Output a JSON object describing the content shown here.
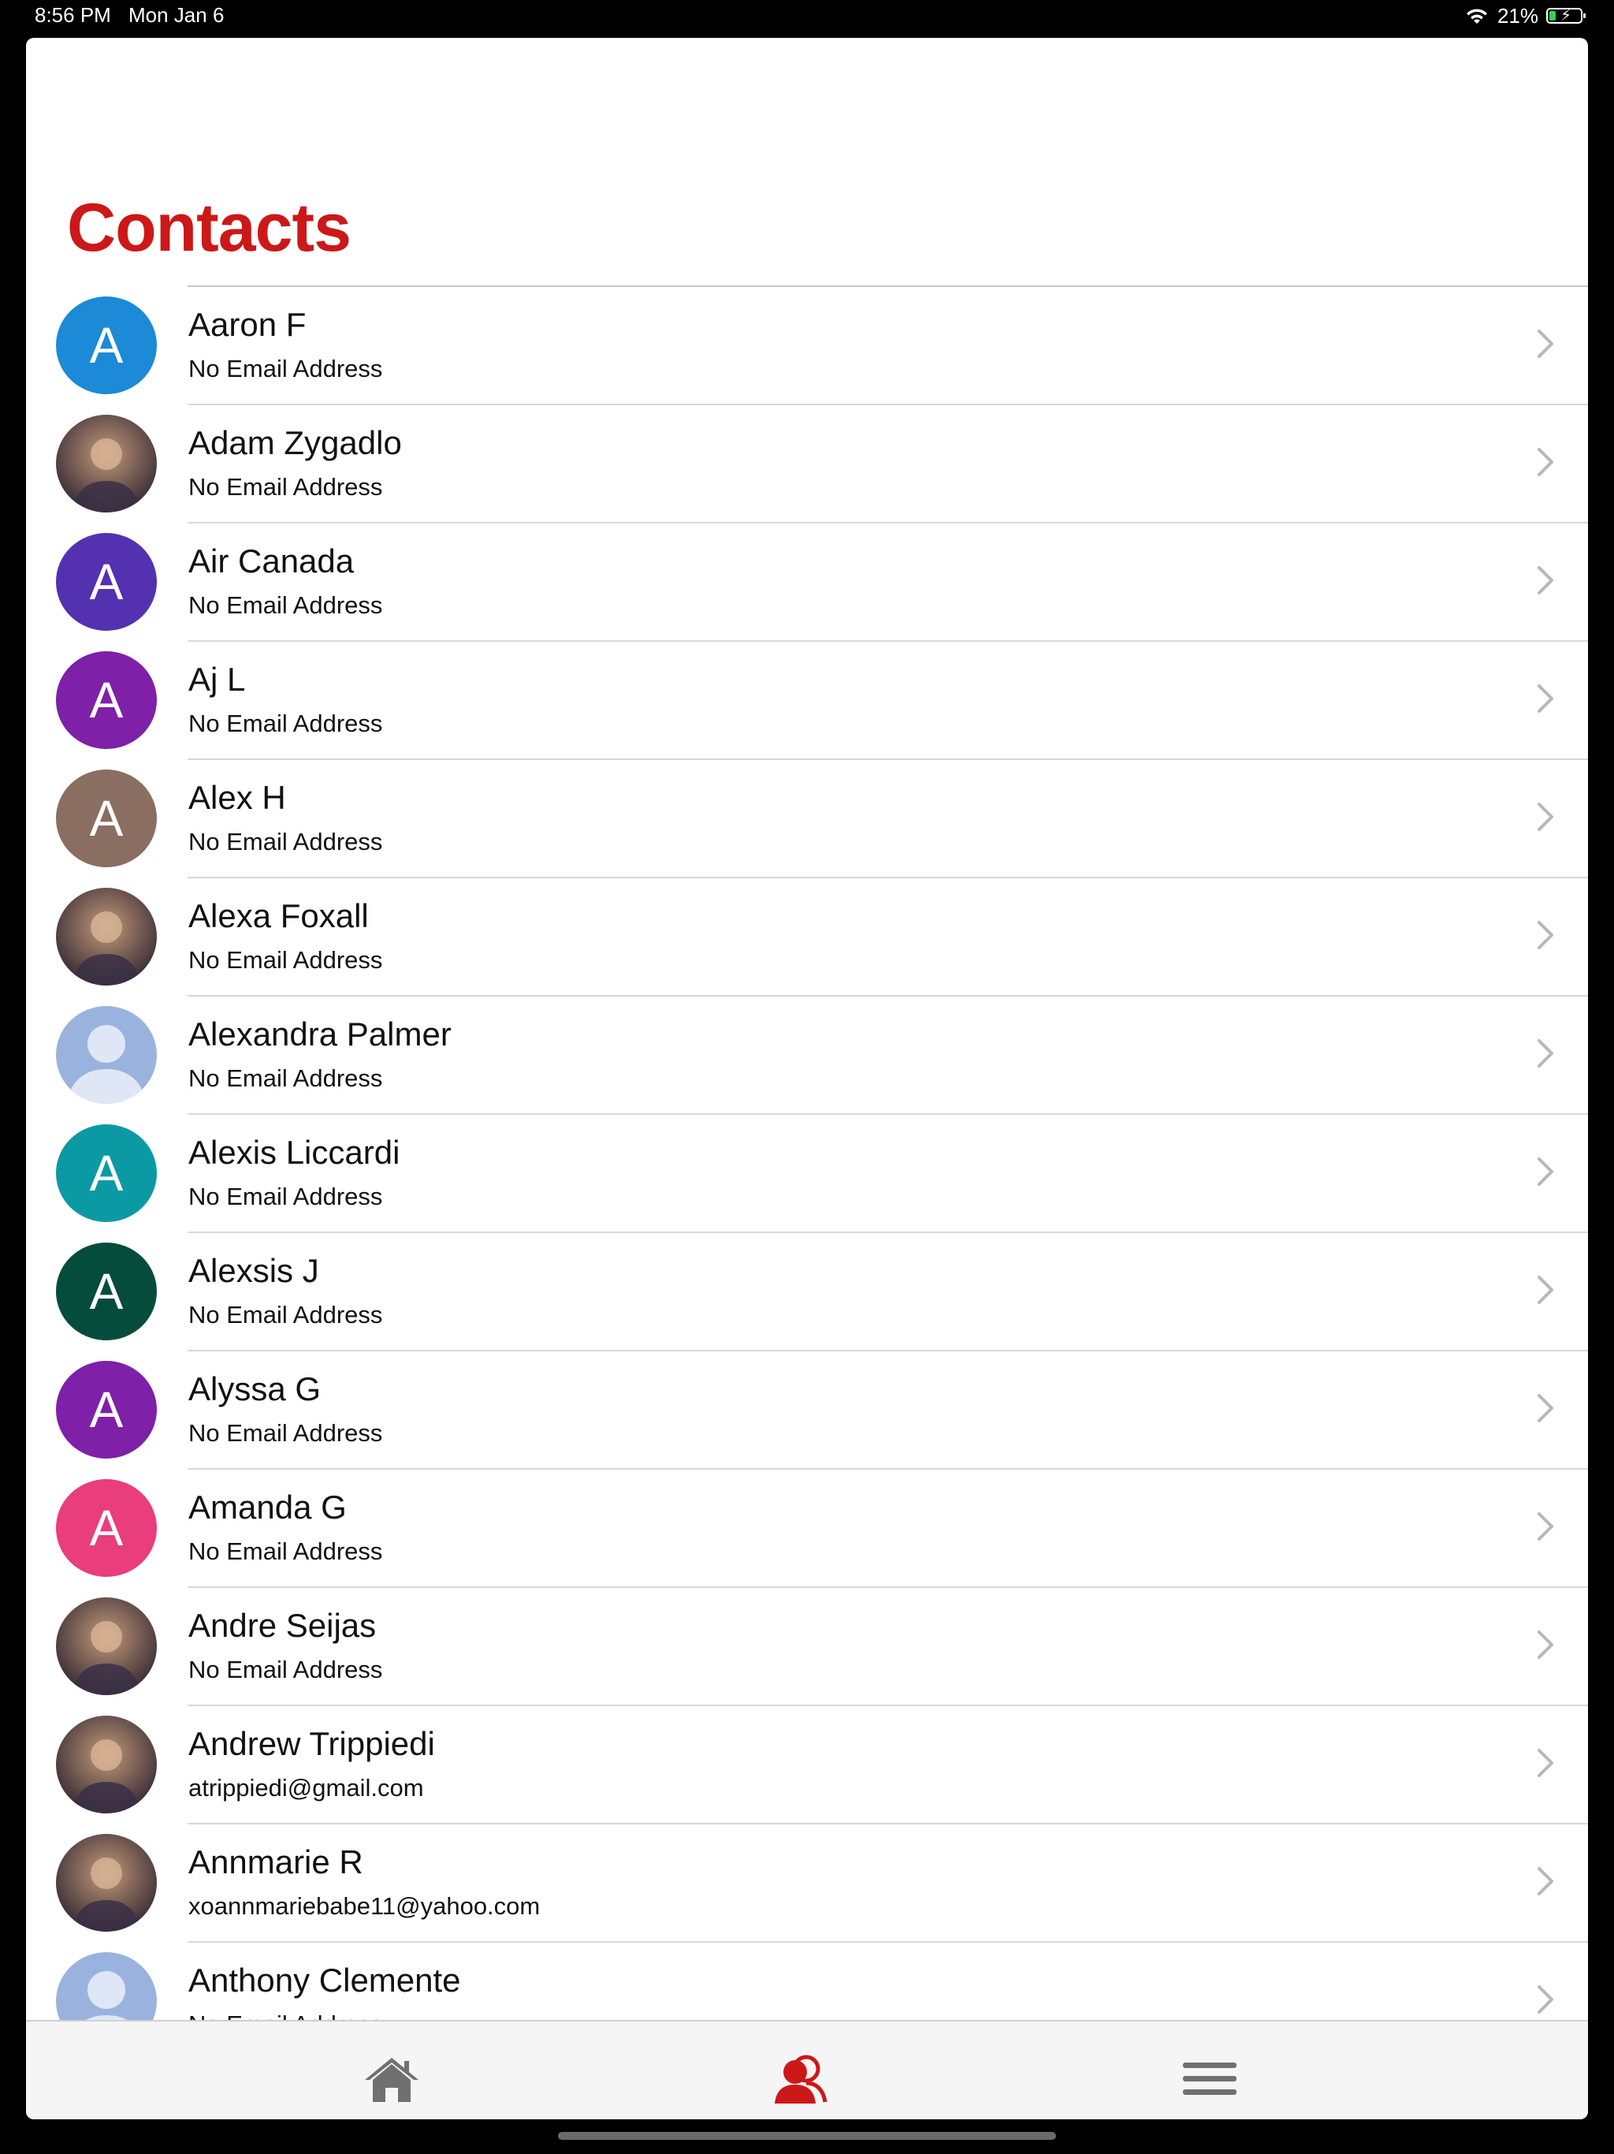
{
  "status": {
    "time": "8:56 PM",
    "date": "Mon Jan 6",
    "battery_percent": "21%",
    "battery_level": 0.21
  },
  "page": {
    "title": "Contacts"
  },
  "colors": {
    "accent": "#cc1818",
    "tab_inactive": "#707070"
  },
  "contacts": [
    {
      "name": "Aaron F",
      "email": "No Email Address",
      "avatar": {
        "type": "initial",
        "letter": "A",
        "color": "#1c8ad6"
      }
    },
    {
      "name": "Adam Zygadlo",
      "email": "No Email Address",
      "avatar": {
        "type": "photo",
        "icon": "photo-avatar-icon"
      }
    },
    {
      "name": "Air Canada",
      "email": "No Email Address",
      "avatar": {
        "type": "initial",
        "letter": "A",
        "color": "#5431b0"
      }
    },
    {
      "name": "Aj L",
      "email": "No Email Address",
      "avatar": {
        "type": "initial",
        "letter": "A",
        "color": "#7e20a8"
      }
    },
    {
      "name": "Alex H",
      "email": "No Email Address",
      "avatar": {
        "type": "initial",
        "letter": "A",
        "color": "#8a6e62"
      }
    },
    {
      "name": "Alexa Foxall",
      "email": "No Email Address",
      "avatar": {
        "type": "photo",
        "icon": "photo-avatar-icon"
      }
    },
    {
      "name": "Alexandra Palmer",
      "email": "No Email Address",
      "avatar": {
        "type": "silhouette",
        "icon": "person-silhouette-icon"
      }
    },
    {
      "name": "Alexis Liccardi",
      "email": "No Email Address",
      "avatar": {
        "type": "initial",
        "letter": "A",
        "color": "#0b9aa3"
      }
    },
    {
      "name": "Alexsis J",
      "email": "No Email Address",
      "avatar": {
        "type": "initial",
        "letter": "A",
        "color": "#064c3c"
      }
    },
    {
      "name": "Alyssa G",
      "email": "No Email Address",
      "avatar": {
        "type": "initial",
        "letter": "A",
        "color": "#7e20a8"
      }
    },
    {
      "name": "Amanda G",
      "email": "No Email Address",
      "avatar": {
        "type": "initial",
        "letter": "A",
        "color": "#e93d7c"
      }
    },
    {
      "name": "Andre Seijas",
      "email": "No Email Address",
      "avatar": {
        "type": "photo",
        "icon": "photo-avatar-icon"
      }
    },
    {
      "name": "Andrew Trippiedi",
      "email": "atrippiedi@gmail.com",
      "avatar": {
        "type": "photo",
        "icon": "photo-avatar-icon"
      }
    },
    {
      "name": "Annmarie R",
      "email": "xoannmariebabe11@yahoo.com",
      "avatar": {
        "type": "photo",
        "icon": "photo-avatar-icon"
      }
    },
    {
      "name": "Anthony Clemente",
      "email": "No Email Address",
      "avatar": {
        "type": "silhouette",
        "icon": "person-silhouette-icon"
      }
    }
  ],
  "tabbar": {
    "items": [
      {
        "id": "home",
        "icon": "home-icon",
        "active": false
      },
      {
        "id": "contacts",
        "icon": "contacts-icon",
        "active": true
      },
      {
        "id": "menu",
        "icon": "hamburger-menu-icon",
        "active": false
      }
    ]
  }
}
